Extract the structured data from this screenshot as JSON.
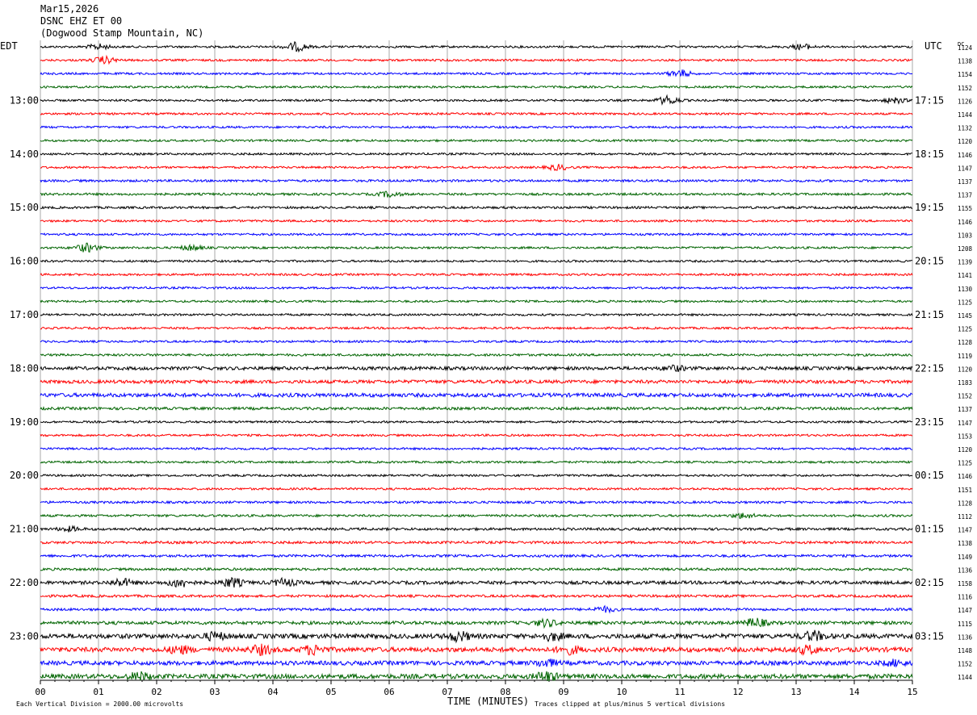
{
  "header": {
    "date": "Mar15,2026",
    "station": "DSNC EHZ ET 00",
    "location": "(Dogwood Stamp Mountain, NC)"
  },
  "left_tz": "EDT",
  "right_tz": "UTC",
  "dc_label": "DC",
  "footer": {
    "scale_note": "Each Vertical Division = 2000.00 microvolts",
    "xlabel": "TIME (MINUTES)",
    "clip_note": "Traces clipped at plus/minus 5 vertical divisions"
  },
  "colors": {
    "trace_cycle": [
      "#000000",
      "#ff0000",
      "#0000ff",
      "#006400"
    ],
    "grid": "#aaaaaa"
  },
  "chart_data": {
    "type": "line",
    "xlabel": "TIME (MINUTES)",
    "xlim": [
      0,
      15
    ],
    "x_ticks": [
      "00",
      "01",
      "02",
      "03",
      "04",
      "05",
      "06",
      "07",
      "08",
      "09",
      "10",
      "11",
      "12",
      "13",
      "14",
      "15"
    ],
    "left_hour_labels": [
      "13:00",
      "14:00",
      "15:00",
      "16:00",
      "17:00",
      "18:00",
      "19:00",
      "20:00",
      "21:00",
      "22:00",
      "23:00"
    ],
    "right_hour_labels": [
      "17:15",
      "18:15",
      "19:15",
      "20:15",
      "21:15",
      "22:15",
      "23:15",
      "00:15",
      "01:15",
      "02:15",
      "03:15"
    ],
    "first_labeled_row": 4,
    "rows_per_hour": 4,
    "dc_offsets": [
      1124,
      1138,
      1154,
      1152,
      1126,
      1144,
      1132,
      1120,
      1146,
      1147,
      1137,
      1137,
      1155,
      1146,
      1103,
      1208,
      1139,
      1141,
      1130,
      1125,
      1145,
      1125,
      1128,
      1119,
      1120,
      1183,
      1152,
      1137,
      1147,
      1153,
      1120,
      1125,
      1146,
      1151,
      1128,
      1112,
      1147,
      1138,
      1149,
      1136,
      1158,
      1116,
      1147,
      1115,
      1136,
      1148,
      1152,
      1144
    ],
    "row_noise_level": [
      1.0,
      1.0,
      1.0,
      1.0,
      1.0,
      1.0,
      1.0,
      1.0,
      1.0,
      1.0,
      1.1,
      1.1,
      1.1,
      1.0,
      1.0,
      1.0,
      1.0,
      1.0,
      1.0,
      1.0,
      1.0,
      1.0,
      1.0,
      1.1,
      1.6,
      1.6,
      1.8,
      1.3,
      1.0,
      1.0,
      1.0,
      1.0,
      1.0,
      1.0,
      1.1,
      1.1,
      1.2,
      1.2,
      1.2,
      1.2,
      1.6,
      1.2,
      1.2,
      1.6,
      2.2,
      2.2,
      2.0,
      2.2
    ],
    "events": [
      {
        "row": 0,
        "minute": 1.0,
        "amp": 3.0
      },
      {
        "row": 0,
        "minute": 4.4,
        "amp": 5.0
      },
      {
        "row": 0,
        "minute": 13.1,
        "amp": 3.0
      },
      {
        "row": 1,
        "minute": 1.1,
        "amp": 4.0
      },
      {
        "row": 2,
        "minute": 11.0,
        "amp": 4.0
      },
      {
        "row": 4,
        "minute": 10.8,
        "amp": 5.0
      },
      {
        "row": 4,
        "minute": 14.7,
        "amp": 3.0
      },
      {
        "row": 9,
        "minute": 8.9,
        "amp": 3.0
      },
      {
        "row": 11,
        "minute": 6.0,
        "amp": 3.0
      },
      {
        "row": 15,
        "minute": 0.8,
        "amp": 5.0
      },
      {
        "row": 15,
        "minute": 2.6,
        "amp": 3.0
      },
      {
        "row": 24,
        "minute": 10.9,
        "amp": 3.0
      },
      {
        "row": 35,
        "minute": 12.1,
        "amp": 3.0
      },
      {
        "row": 36,
        "minute": 0.5,
        "amp": 2.5
      },
      {
        "row": 40,
        "minute": 1.4,
        "amp": 4.0
      },
      {
        "row": 40,
        "minute": 2.4,
        "amp": 5.0
      },
      {
        "row": 40,
        "minute": 3.3,
        "amp": 5.0
      },
      {
        "row": 40,
        "minute": 4.2,
        "amp": 4.0
      },
      {
        "row": 42,
        "minute": 9.7,
        "amp": 3.0
      },
      {
        "row": 43,
        "minute": 8.7,
        "amp": 4.0
      },
      {
        "row": 43,
        "minute": 12.3,
        "amp": 5.0
      },
      {
        "row": 44,
        "minute": 3.0,
        "amp": 4.0
      },
      {
        "row": 44,
        "minute": 7.2,
        "amp": 5.0
      },
      {
        "row": 44,
        "minute": 8.8,
        "amp": 4.0
      },
      {
        "row": 44,
        "minute": 13.3,
        "amp": 5.0
      },
      {
        "row": 45,
        "minute": 2.4,
        "amp": 4.0
      },
      {
        "row": 45,
        "minute": 3.8,
        "amp": 5.0
      },
      {
        "row": 45,
        "minute": 4.7,
        "amp": 5.0
      },
      {
        "row": 45,
        "minute": 9.1,
        "amp": 4.0
      },
      {
        "row": 45,
        "minute": 13.2,
        "amp": 4.0
      },
      {
        "row": 46,
        "minute": 8.7,
        "amp": 4.0
      },
      {
        "row": 46,
        "minute": 14.7,
        "amp": 3.0
      },
      {
        "row": 47,
        "minute": 1.7,
        "amp": 4.0
      },
      {
        "row": 47,
        "minute": 8.7,
        "amp": 5.0
      }
    ]
  }
}
